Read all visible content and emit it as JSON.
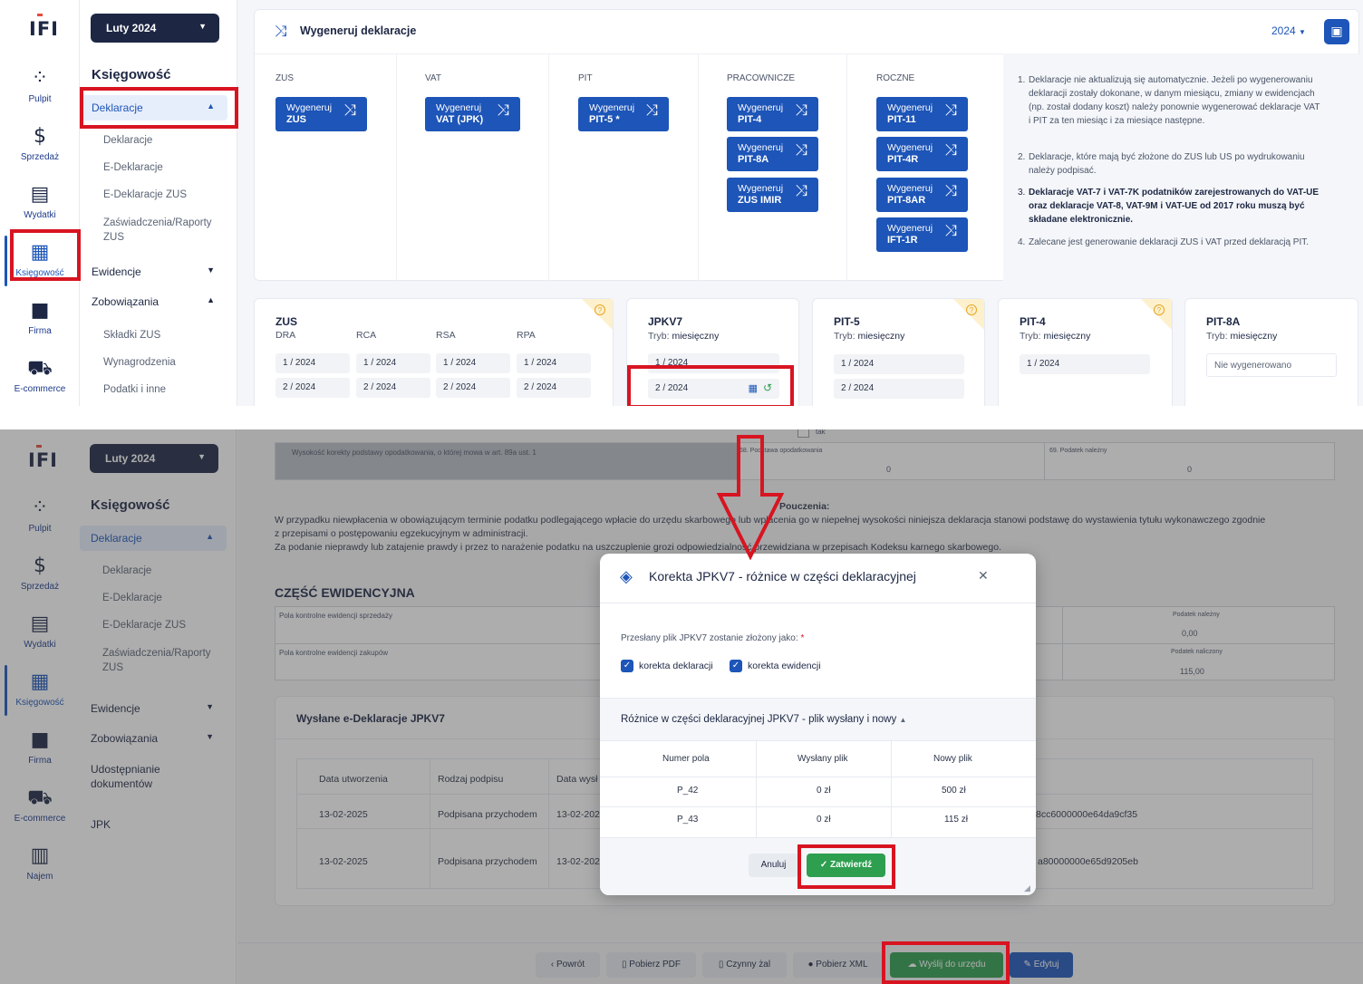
{
  "brand": {
    "logo": "IFI"
  },
  "rail": [
    {
      "label": "Pulpit",
      "icon": "dashboard-icon",
      "glyph": "⁘"
    },
    {
      "label": "Sprzedaż",
      "icon": "invoice-dollar-icon",
      "glyph": "$"
    },
    {
      "label": "Wydatki",
      "icon": "receipt-icon",
      "glyph": "▤"
    },
    {
      "label": "Księgowość",
      "icon": "grid-apps-icon",
      "glyph": "▦"
    },
    {
      "label": "Firma",
      "icon": "briefcase-icon",
      "glyph": "■"
    },
    {
      "label": "E-commerce",
      "icon": "cart-icon",
      "glyph": "⛟"
    },
    {
      "label": "Najem",
      "icon": "building-icon",
      "glyph": "▥"
    }
  ],
  "nav": {
    "month": "Luty 2024",
    "heading": "Księgowość",
    "deklaracje": "Deklaracje",
    "sub": [
      "Deklaracje",
      "E-Deklaracje",
      "E-Deklaracje ZUS",
      "Zaświadczenia/Raporty ZUS"
    ],
    "ewidencje": "Ewidencje",
    "zobowiazania": "Zobowiązania",
    "zob_sub": [
      "Składki ZUS",
      "Wynagrodzenia",
      "Podatki i inne"
    ],
    "udostepnianie": "Udostępnianie dokumentów",
    "jpk": "JPK"
  },
  "generate": {
    "title": "Wygeneruj deklaracje",
    "year": "2024",
    "columns": [
      "ZUS",
      "VAT",
      "PIT",
      "PRACOWNICZE",
      "ROCZNE"
    ],
    "btn_prefix": "Wygeneruj",
    "zus": [
      "ZUS"
    ],
    "vat": [
      "VAT (JPK)"
    ],
    "pit": [
      "PIT-5 *"
    ],
    "prac": [
      "PIT-4",
      "PIT-8A",
      "ZUS IMIR"
    ],
    "roczne": [
      "PIT-11",
      "PIT-4R",
      "PIT-8AR",
      "IFT-1R"
    ],
    "notes": [
      "Deklaracje nie aktualizują się automatycznie. Jeżeli po wygenerowaniu deklaracji zostały dokonane, w danym miesiącu, zmiany w ewidencjach (np. został dodany koszt) należy ponownie wygenerować deklaracje VAT i PIT za ten miesiąc i za miesiące następne.",
      "Deklaracje, które mają być złożone do ZUS lub US po wydrukowaniu należy podpisać.",
      "Deklaracje VAT-7 i VAT-7K podatników zarejestrowanych do VAT-UE oraz deklaracje VAT-8, VAT-9M i VAT-UE od 2017 roku muszą być składane elektronicznie.",
      "Zalecane jest generowanie deklaracji ZUS i VAT przed deklaracją PIT."
    ]
  },
  "cards": {
    "zus": {
      "title": "ZUS",
      "cols": [
        "DRA",
        "RCA",
        "RSA",
        "RPA"
      ],
      "rows": [
        [
          "1 / 2024",
          "1 / 2024",
          "1 / 2024",
          "1 / 2024"
        ],
        [
          "2 / 2024",
          "2 / 2024",
          "2 / 2024",
          "2 / 2024"
        ]
      ]
    },
    "jpkv7": {
      "title": "JPKV7",
      "tryb_label": "Tryb:",
      "tryb": "miesięczny",
      "rows": [
        "1 / 2024",
        "2 / 2024"
      ]
    },
    "pit5": {
      "title": "PIT-5",
      "tryb_label": "Tryb:",
      "tryb": "miesięczny",
      "rows": [
        "1 / 2024",
        "2 / 2024"
      ]
    },
    "pit4": {
      "title": "PIT-4",
      "tryb_label": "Tryb:",
      "tryb": "miesięczny",
      "rows": [
        "1 / 2024"
      ]
    },
    "pit8a": {
      "title": "PIT-8A",
      "tryb_label": "Tryb:",
      "tryb": "miesięczny",
      "empty": "Nie wygenerowano"
    }
  },
  "doc": {
    "tak": "tak",
    "row_label": "Wysokość korekty podstawy opodatkowania, o której mowa w art. 89a ust. 1",
    "f68": "68. Podstawa opodatkowania",
    "f69": "69. Podatek należny",
    "f68_val": "0",
    "f69_val": "0",
    "pouczenia_title": "Pouczenia:",
    "pouczenia": [
      "W przypadku niewpłacenia w obowiązującym terminie podatku podlegającego wpłacie do urzędu skarbowego lub wpłacenia go w niepełnej wysokości niniejsza deklaracja stanowi podstawę do wystawienia tytułu wykonawczego zgodnie",
      "z przepisami o postępowaniu egzekucyjnym w administracji.",
      "Za podanie nieprawdy lub zatajenie prawdy i przez to narażenie podatku na uszczuplenie grozi odpowiedzialność przewidziana w przepisach Kodeksu karnego skarbowego."
    ],
    "czesc": "CZĘŚĆ EWIDENCYJNA",
    "pola_sprzedazy": "Pola kontrolne ewidencji sprzedaży",
    "pola_zakupow": "Pola kontrolne ewidencji zakupów",
    "podatek_nalezny": "Podatek należny",
    "podatek_nalezny_val": "0,00",
    "podatek_naliczony": "Podatek naliczony",
    "podatek_naliczony_val": "115,00",
    "sent_title": "Wysłane e-Deklaracje JPKV7",
    "sent_headers": [
      "Data utworzenia",
      "Rodzaj podpisu",
      "Data wysł"
    ],
    "sent_rows": [
      {
        "date": "13-02-2025",
        "sign": "Podpisana przychodem",
        "sent": "13-02-202",
        "id": "8cc6000000e64da9cf35"
      },
      {
        "date": "13-02-2025",
        "sign": "Podpisana przychodem",
        "sent": "13-02-202",
        "id": "a80000000e65d9205eb"
      }
    ]
  },
  "toolbar": [
    "Powrót",
    "Pobierz PDF",
    "Czynny żal",
    "Pobierz XML",
    "Wyślij do urzędu",
    "Edytuj"
  ],
  "modal": {
    "title": "Korekta JPKV7 - różnice w części deklaracyjnej",
    "question": "Przesłany plik JPKV7 zostanie złożony jako:",
    "required": "*",
    "opt1": "korekta deklaracji",
    "opt2": "korekta ewidencji",
    "diff_title": "Różnice w części deklaracyjnej JPKV7 - plik wysłany i nowy",
    "headers": [
      "Numer pola",
      "Wysłany plik",
      "Nowy plik"
    ],
    "rows": [
      [
        "P_42",
        "0 zł",
        "500 zł"
      ],
      [
        "P_43",
        "0 zł",
        "115 zł"
      ]
    ],
    "cancel": "Anuluj",
    "confirm": "Zatwierdź"
  },
  "colors": {
    "primary": "#1d55b8",
    "dark": "#1d2744",
    "success": "#2e9e4f",
    "highlight": "#d81421"
  }
}
